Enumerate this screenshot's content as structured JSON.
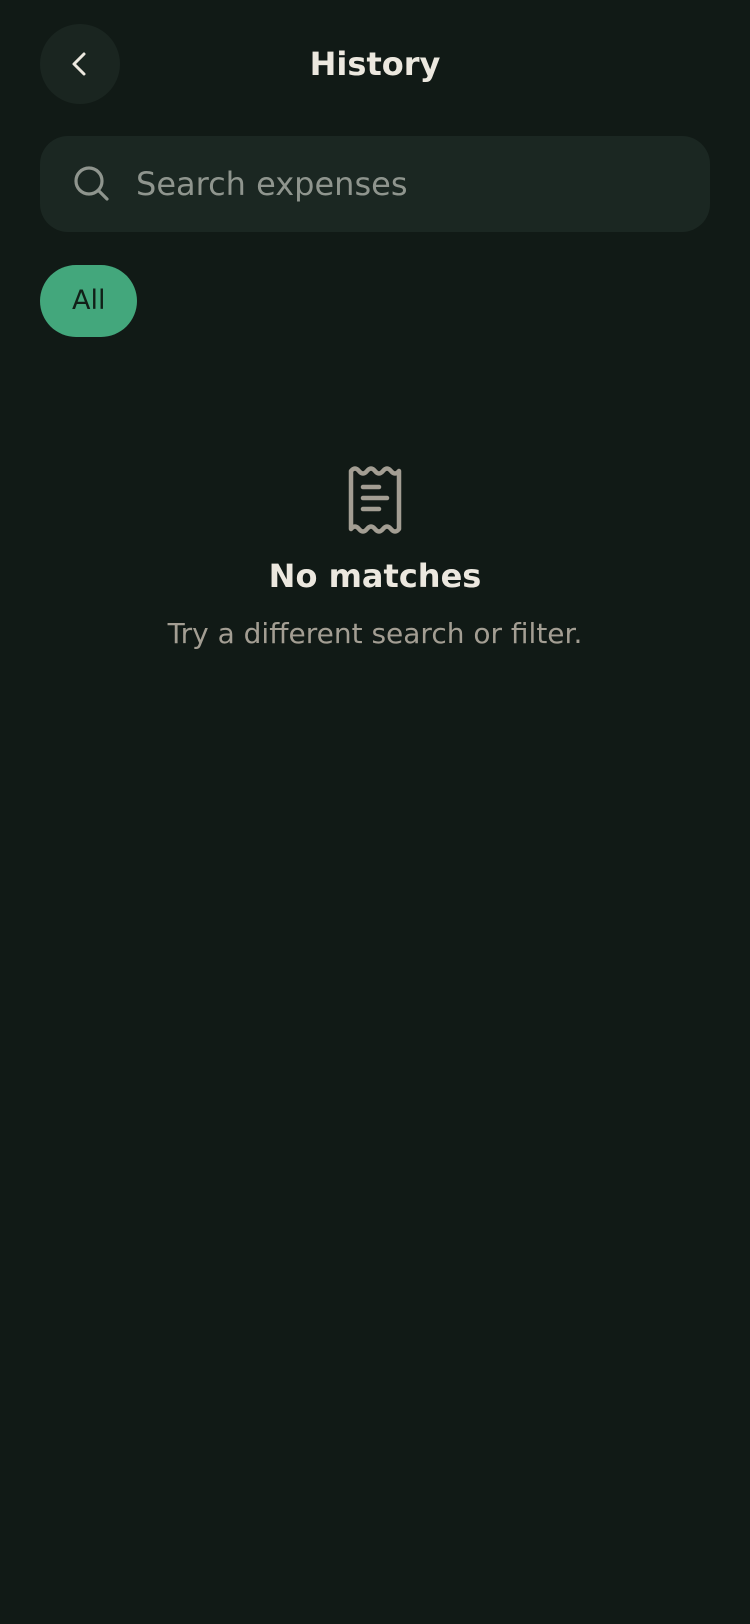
{
  "header": {
    "title": "History",
    "back_icon": "chevron-left-icon"
  },
  "search": {
    "placeholder": "Search expenses",
    "value": "",
    "icon": "search-icon"
  },
  "filters": {
    "items": [
      {
        "label": "All",
        "selected": true
      }
    ]
  },
  "empty_state": {
    "icon": "receipt-icon",
    "title": "No matches",
    "subtitle": "Try a different search or filter."
  },
  "colors": {
    "background": "#111a16",
    "surface": "#1b2722",
    "accent": "#43a77c",
    "text_primary": "#ece8df",
    "text_secondary": "#a39e93"
  }
}
